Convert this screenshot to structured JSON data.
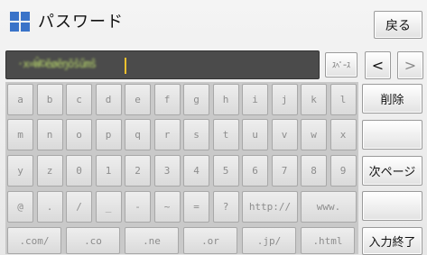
{
  "header": {
    "title": "パスワード",
    "back_label": "戻る"
  },
  "input": {
    "value": "·x=Ŵ©ĕøĕŋŏŝűmŝ"
  },
  "controls": {
    "space_label": "ｽﾍﾟｰｽ",
    "left_arrow": "<",
    "right_arrow": ">"
  },
  "keyboard": {
    "rows": [
      [
        "a",
        "b",
        "c",
        "d",
        "e",
        "f",
        "g",
        "h",
        "i",
        "j",
        "k",
        "l"
      ],
      [
        "m",
        "n",
        "o",
        "p",
        "q",
        "r",
        "s",
        "t",
        "u",
        "v",
        "w",
        "x"
      ],
      [
        "y",
        "z",
        "0",
        "1",
        "2",
        "3",
        "4",
        "5",
        "6",
        "7",
        "8",
        "9"
      ],
      [
        "@",
        ".",
        "/",
        "_",
        "-",
        "~",
        "=",
        "?",
        "http://",
        "www."
      ],
      [
        ".com/",
        ".co",
        ".ne",
        ".or",
        ".jp/",
        ".html"
      ]
    ]
  },
  "side_buttons": {
    "delete_label": "削除",
    "next_page_label": "次ページ",
    "finish_label": "入力終了"
  }
}
